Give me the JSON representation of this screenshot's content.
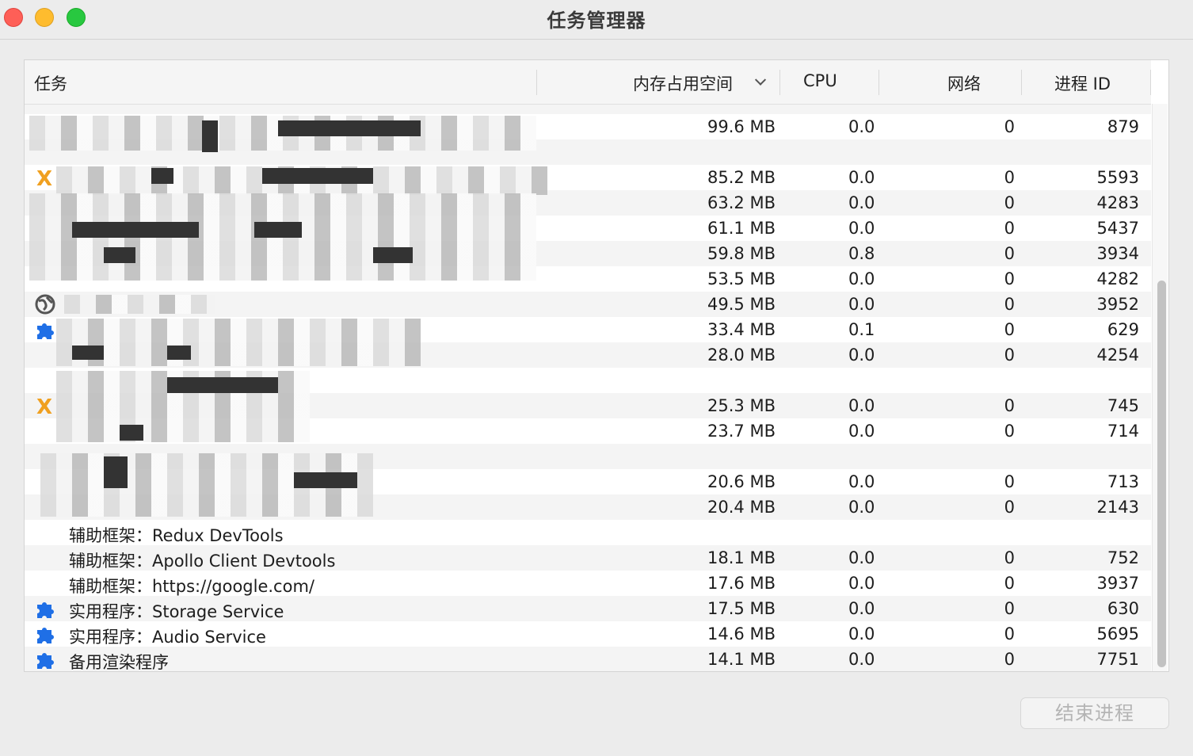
{
  "window": {
    "title": "任务管理器"
  },
  "table": {
    "headers": {
      "task": "任务",
      "memory": "内存占用空间",
      "cpu": "CPU",
      "network": "网络",
      "pid": "进程 ID"
    },
    "rows": [
      {
        "name": "",
        "memory": "99.6 MB",
        "cpu": "0.0",
        "network": "0",
        "pid": "879",
        "icon": "blurred"
      },
      {
        "name": "",
        "memory": "85.2 MB",
        "cpu": "0.0",
        "network": "0",
        "pid": "5593",
        "icon": "x-icon"
      },
      {
        "name": "",
        "memory": "63.2 MB",
        "cpu": "0.0",
        "network": "0",
        "pid": "4283",
        "icon": "blurred"
      },
      {
        "name": "",
        "memory": "61.1 MB",
        "cpu": "0.0",
        "network": "0",
        "pid": "5437",
        "icon": "blurred"
      },
      {
        "name": "",
        "memory": "59.8 MB",
        "cpu": "0.8",
        "network": "0",
        "pid": "3934",
        "icon": "blurred"
      },
      {
        "name": "",
        "memory": "53.5 MB",
        "cpu": "0.0",
        "network": "0",
        "pid": "4282",
        "icon": "blurred"
      },
      {
        "name": "",
        "memory": "49.5 MB",
        "cpu": "0.0",
        "network": "0",
        "pid": "3952",
        "icon": "globe-icon"
      },
      {
        "name": "",
        "memory": "33.4 MB",
        "cpu": "0.1",
        "network": "0",
        "pid": "629",
        "icon": "puzzle-icon"
      },
      {
        "name": "",
        "memory": "28.0 MB",
        "cpu": "0.0",
        "network": "0",
        "pid": "4254",
        "icon": "blurred"
      },
      {
        "name": "",
        "memory": "",
        "cpu": "",
        "network": "",
        "pid": "",
        "icon": "blurred"
      },
      {
        "name": "",
        "memory": "25.3 MB",
        "cpu": "0.0",
        "network": "0",
        "pid": "745",
        "icon": "x-icon"
      },
      {
        "name": "",
        "memory": "23.7 MB",
        "cpu": "0.0",
        "network": "0",
        "pid": "714",
        "icon": "blurred"
      },
      {
        "name": "",
        "memory": "",
        "cpu": "",
        "network": "",
        "pid": "",
        "icon": "blurred"
      },
      {
        "name": "",
        "memory": "20.6 MB",
        "cpu": "0.0",
        "network": "0",
        "pid": "713",
        "icon": "blurred"
      },
      {
        "name": "",
        "memory": "20.4 MB",
        "cpu": "0.0",
        "network": "0",
        "pid": "2143",
        "icon": "blurred"
      },
      {
        "name": "辅助框架：Redux DevTools",
        "memory": "",
        "cpu": "",
        "network": "",
        "pid": "",
        "icon": ""
      },
      {
        "name": "辅助框架：Apollo Client Devtools",
        "memory": "18.1 MB",
        "cpu": "0.0",
        "network": "0",
        "pid": "752",
        "icon": ""
      },
      {
        "name": "辅助框架：https://google.com/",
        "memory": "17.6 MB",
        "cpu": "0.0",
        "network": "0",
        "pid": "3937",
        "icon": ""
      },
      {
        "name": "实用程序：Storage Service",
        "memory": "17.5 MB",
        "cpu": "0.0",
        "network": "0",
        "pid": "630",
        "icon": "puzzle-icon"
      },
      {
        "name": "实用程序：Audio Service",
        "memory": "14.6 MB",
        "cpu": "0.0",
        "network": "0",
        "pid": "5695",
        "icon": "puzzle-icon"
      },
      {
        "name": "备用渲染程序",
        "memory": "14.1 MB",
        "cpu": "0.0",
        "network": "0",
        "pid": "7751",
        "icon": "puzzle-icon"
      }
    ]
  },
  "footer": {
    "end_process_label": "结束进程"
  },
  "colors": {
    "accent_puzzle": "#1f6fe6",
    "accent_x": "#f0a020"
  }
}
